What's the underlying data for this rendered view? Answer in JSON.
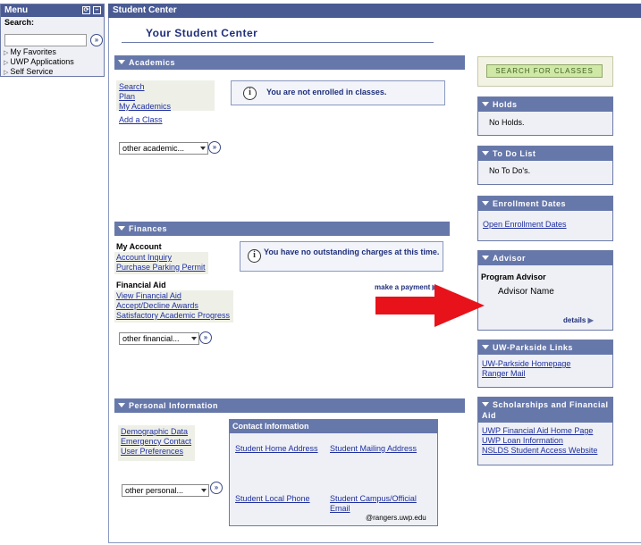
{
  "menu": {
    "title": "Menu",
    "search_label": "Search:",
    "items": [
      {
        "label": "My Favorites"
      },
      {
        "label": "UWP Applications"
      },
      {
        "label": "Self Service"
      }
    ]
  },
  "header": {
    "title": "Student Center"
  },
  "page_title": "Your Student Center",
  "academics": {
    "title": "Academics",
    "links": [
      "Search",
      "Plan",
      "My Academics"
    ],
    "add_class": "Add a Class",
    "notice": "You are not enrolled in classes.",
    "dropdown": "other academic..."
  },
  "finances": {
    "title": "Finances",
    "my_account_label": "My Account",
    "account_links": [
      "Account Inquiry",
      "Purchase Parking Permit"
    ],
    "notice": "You have no outstanding charges at this time.",
    "financial_aid_label": "Financial Aid",
    "aid_links": [
      "View Financial Aid",
      "Accept/Decline Awards",
      "Satisfactory Academic Progress"
    ],
    "make_payment": "make a payment",
    "dropdown": "other financial..."
  },
  "personal": {
    "title": "Personal Information",
    "links": [
      "Demographic Data",
      "Emergency Contact",
      "User Preferences"
    ],
    "dropdown": "other personal...",
    "contact": {
      "title": "Contact Information",
      "home_address": "Student Home Address",
      "mailing_address": "Student Mailing Address",
      "local_phone": "Student Local Phone",
      "campus_email": "Student Campus/Official Email",
      "email_domain": "@rangers.uwp.edu"
    }
  },
  "right": {
    "search_button": "SEARCH FOR CLASSES",
    "holds": {
      "title": "Holds",
      "body": "No Holds."
    },
    "todo": {
      "title": "To Do List",
      "body": "No To Do's."
    },
    "enrollment": {
      "title": "Enrollment Dates",
      "link": "Open Enrollment Dates"
    },
    "advisor": {
      "title": "Advisor",
      "label": "Program Advisor",
      "name": "Advisor Name",
      "details": "details"
    },
    "links": {
      "title": "UW-Parkside Links",
      "items": [
        "UW-Parkside Homepage",
        "Ranger Mail"
      ]
    },
    "scholarships": {
      "title": "Scholarships and Financial Aid",
      "items": [
        "UWP Financial Aid Home Page",
        "UWP Loan Information",
        "NSLDS Student Access Website"
      ]
    }
  },
  "colors": {
    "header_bg": "#4a5b93",
    "section_bg": "#6677aa",
    "link": "#1f2fa0",
    "arrow": "#e8121a",
    "button_bg": "#cfe8a6"
  }
}
